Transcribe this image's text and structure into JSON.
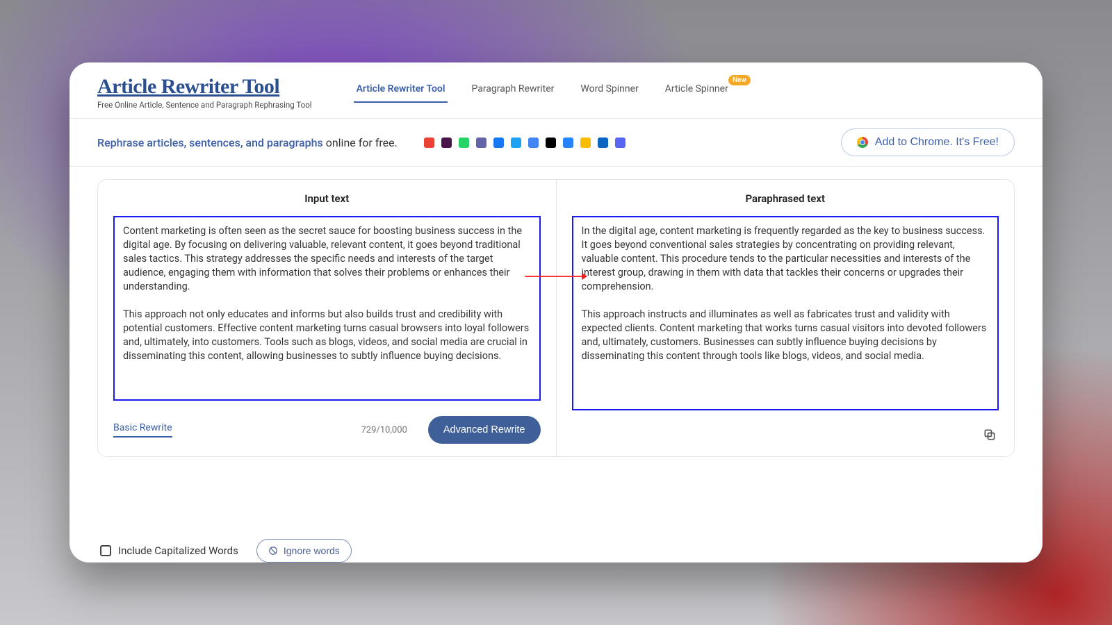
{
  "brand": {
    "title": "Article Rewriter Tool",
    "subtitle": "Free Online Article, Sentence and Paragraph Rephrasing Tool"
  },
  "nav": {
    "items": [
      {
        "label": "Article Rewriter Tool",
        "active": true
      },
      {
        "label": "Paragraph Rewriter",
        "active": false
      },
      {
        "label": "Word Spinner",
        "active": false
      },
      {
        "label": "Article Spinner",
        "active": false,
        "badge": "New"
      }
    ]
  },
  "tagline": {
    "highlighted": "Rephrase articles, sentences, and paragraphs",
    "rest": " online for free."
  },
  "app_icons": [
    {
      "name": "gmail",
      "color": "#ea4335"
    },
    {
      "name": "slack",
      "color": "#4a154b"
    },
    {
      "name": "whatsapp",
      "color": "#25d366"
    },
    {
      "name": "teams",
      "color": "#6264a7"
    },
    {
      "name": "facebook",
      "color": "#1877f2"
    },
    {
      "name": "twitter",
      "color": "#1da1f2"
    },
    {
      "name": "docs",
      "color": "#4285f4"
    },
    {
      "name": "notion",
      "color": "#000000"
    },
    {
      "name": "confluence",
      "color": "#2684ff"
    },
    {
      "name": "keep",
      "color": "#fbbc04"
    },
    {
      "name": "linkedin",
      "color": "#0a66c2"
    },
    {
      "name": "discord",
      "color": "#5865f2"
    }
  ],
  "chrome_btn": "Add to Chrome. It's Free!",
  "panels": {
    "input": {
      "title": "Input text",
      "text": "Content marketing is often seen as the secret sauce for boosting business success in the digital age. By focusing on delivering valuable, relevant content, it goes beyond traditional sales tactics. This strategy addresses the specific needs and interests of the target audience, engaging them with information that solves their problems or enhances their understanding.\n\nThis approach not only educates and informs but also builds trust and credibility with potential customers. Effective content marketing turns casual browsers into loyal followers and, ultimately, into customers. Tools such as blogs, videos, and social media are crucial in disseminating this content, allowing businesses to subtly influence buying decisions.",
      "mode": "Basic Rewrite",
      "counter": "729/10,000",
      "advanced_btn": "Advanced Rewrite"
    },
    "output": {
      "title": "Paraphrased text",
      "text": "In the digital age, content marketing is frequently regarded as the key to business success. It goes beyond conventional sales strategies by concentrating on providing relevant, valuable content. This procedure tends to the particular necessities and interests of the interest group, drawing in them with data that tackles their concerns or upgrades their comprehension.\n\nThis approach instructs and illuminates as well as fabricates trust and validity with expected clients. Content marketing that works turns casual visitors into devoted followers and, ultimately, customers. Businesses can subtly influence buying decisions by disseminating this content through tools like blogs, videos, and social media."
    }
  },
  "options": {
    "capitalized": "Include Capitalized Words",
    "ignore": "Ignore words"
  }
}
